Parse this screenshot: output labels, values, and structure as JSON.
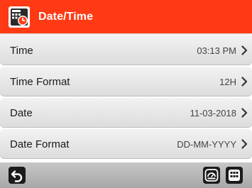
{
  "header": {
    "title": "Date/Time",
    "icon": "datetime-settings-icon",
    "color": "#ff3a14"
  },
  "rows": [
    {
      "label": "Time",
      "value": "03:13 PM"
    },
    {
      "label": "Time Format",
      "value": "12H"
    },
    {
      "label": "Date",
      "value": "11-03-2018"
    },
    {
      "label": "Date Format",
      "value": "DD-MM-YYYY"
    }
  ],
  "footer": {
    "left_icon": "back-arrow-icon",
    "right_icons": [
      "dashboard-icon",
      "grid-menu-icon"
    ]
  }
}
